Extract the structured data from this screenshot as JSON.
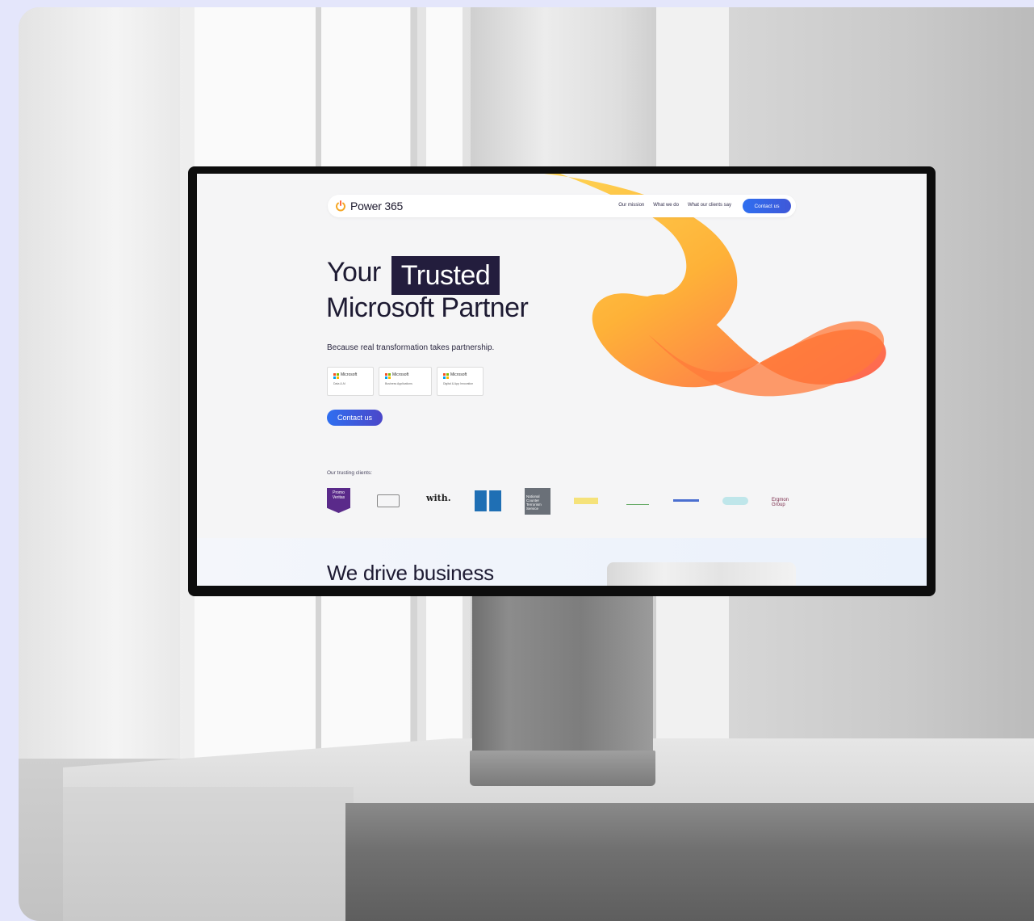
{
  "brand": {
    "name": "Power 365",
    "accent": "#f5a623",
    "cta_color": "#2f6ff0"
  },
  "nav": {
    "links": [
      "Our mission",
      "What we do",
      "What our clients say"
    ],
    "cta": "Contact us"
  },
  "hero": {
    "title_line1": "Your",
    "title_highlight": "Trusted",
    "title_line2": "Microsoft Partner",
    "subtitle": "Because real transformation takes partnership.",
    "badges": [
      {
        "brand": "Microsoft",
        "label": "Data & AI"
      },
      {
        "brand": "Microsoft",
        "label": "Business Applications"
      },
      {
        "brand": "Microsoft",
        "label": "Digital & App Innovation"
      }
    ],
    "cta": "Contact us"
  },
  "clients": {
    "label": "Our trusting clients:",
    "logos": [
      "Promo Veritas",
      "with.",
      "National Counter Terrorism Service",
      "Ergmon Group"
    ]
  },
  "next_section": {
    "title": "We drive business"
  }
}
